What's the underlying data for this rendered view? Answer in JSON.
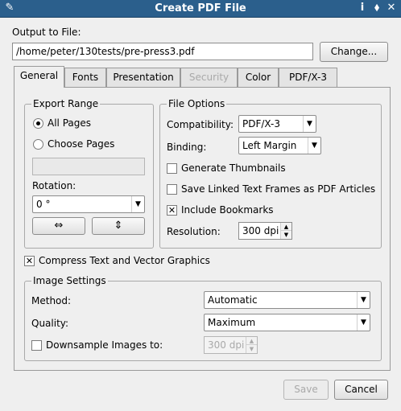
{
  "window": {
    "title": "Create PDF File"
  },
  "output": {
    "label": "Output to File:",
    "path": "/home/peter/130tests/pre-press3.pdf",
    "change_button": "Change..."
  },
  "tabs": [
    {
      "label": "General",
      "active": true
    },
    {
      "label": "Fonts"
    },
    {
      "label": "Presentation"
    },
    {
      "label": "Security",
      "disabled": true
    },
    {
      "label": "Color"
    },
    {
      "label": "PDF/X-3"
    }
  ],
  "export_range": {
    "title": "Export Range",
    "all_pages": "All Pages",
    "choose_pages": "Choose Pages",
    "pages_value": "",
    "rotation_label": "Rotation:",
    "rotation_value": "0 °"
  },
  "file_options": {
    "title": "File Options",
    "compatibility_label": "Compatibility:",
    "compatibility_value": "PDF/X-3",
    "binding_label": "Binding:",
    "binding_value": "Left Margin",
    "generate_thumbnails": "Generate Thumbnails",
    "save_linked_text": "Save Linked Text Frames as PDF Articles",
    "include_bookmarks": "Include Bookmarks",
    "resolution_label": "Resolution:",
    "resolution_value": "300 dpi"
  },
  "compress": {
    "label": "Compress Text and Vector Graphics"
  },
  "image_settings": {
    "title": "Image Settings",
    "method_label": "Method:",
    "method_value": "Automatic",
    "quality_label": "Quality:",
    "quality_value": "Maximum",
    "downsample_label": "Downsample Images to:",
    "downsample_value": "300 dpi"
  },
  "buttons": {
    "save": "Save",
    "cancel": "Cancel"
  }
}
